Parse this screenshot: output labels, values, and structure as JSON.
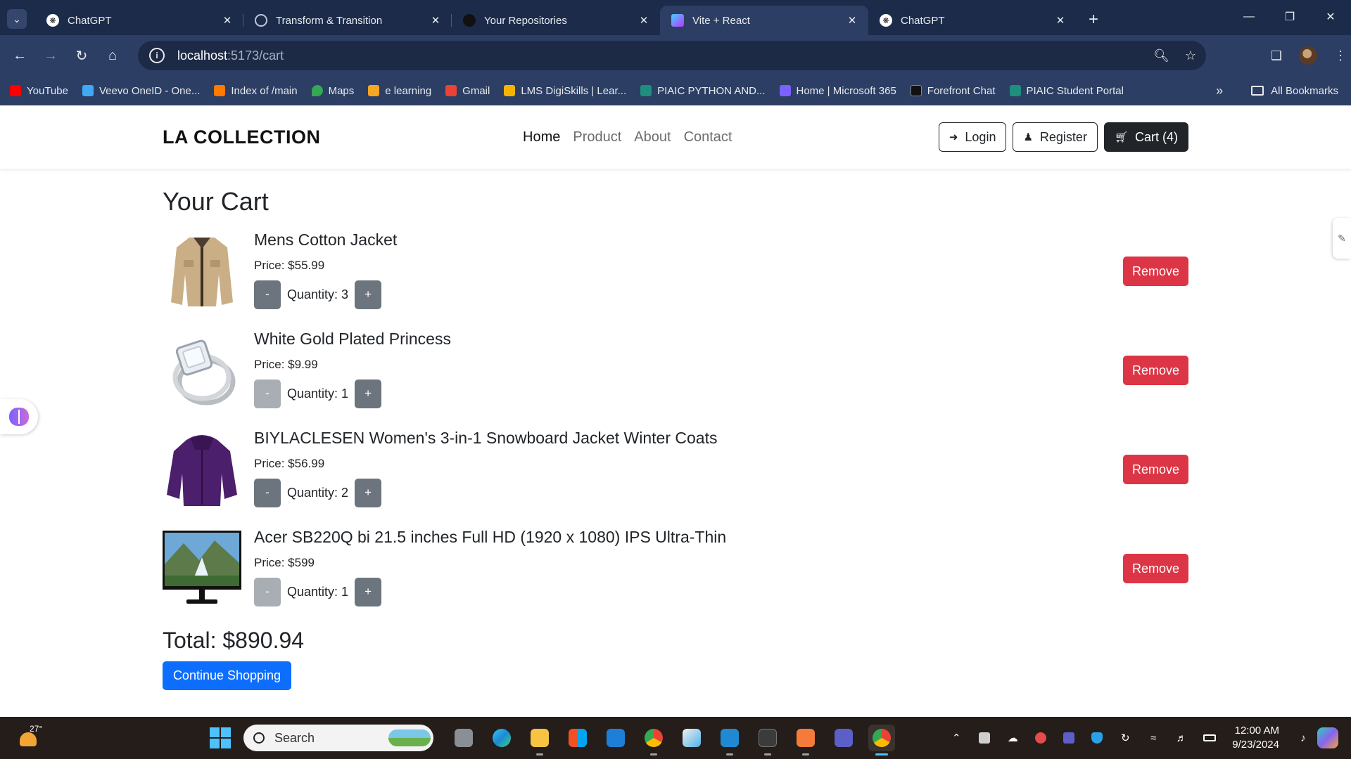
{
  "browser": {
    "tabs": [
      {
        "title": "ChatGPT",
        "icon": "chatgpt-icon",
        "active": false
      },
      {
        "title": "Transform & Transition",
        "icon": "globe-icon",
        "active": false
      },
      {
        "title": "Your Repositories",
        "icon": "github-icon",
        "active": false
      },
      {
        "title": "Vite + React",
        "icon": "vite-icon",
        "active": true
      },
      {
        "title": "ChatGPT",
        "icon": "chatgpt-icon",
        "active": false
      }
    ],
    "url_host": "localhost",
    "url_path": ":5173/cart",
    "bookmarks": [
      {
        "label": "YouTube",
        "color": "#ff0000"
      },
      {
        "label": "Veevo OneID - One...",
        "color": "#3fa9f5"
      },
      {
        "label": "Index of /main",
        "color": "#ff7a00"
      },
      {
        "label": "Maps",
        "color": "#34a853"
      },
      {
        "label": "e learning",
        "color": "#f5a623"
      },
      {
        "label": "Gmail",
        "color": "#ea4335"
      },
      {
        "label": "LMS DigiSkills | Lear...",
        "color": "#f6b400"
      },
      {
        "label": "PIAIC PYTHON AND...",
        "color": "#1e8e7e"
      },
      {
        "label": "Home | Microsoft 365",
        "color": "#7b61ff"
      },
      {
        "label": "Forefront Chat",
        "color": "#111111"
      },
      {
        "label": "PIAIC Student Portal",
        "color": "#1e8e7e"
      }
    ],
    "all_bookmarks_label": "All Bookmarks"
  },
  "site": {
    "brand": "LA COLLECTION",
    "menu": [
      "Home",
      "Product",
      "About",
      "Contact"
    ],
    "login_label": "Login",
    "register_label": "Register",
    "cart_label": "Cart (4)"
  },
  "cart": {
    "title": "Your Cart",
    "items": [
      {
        "name": "Mens Cotton Jacket",
        "price": "Price: $55.99",
        "quantity": "Quantity: 3",
        "thumbnail": "jacket-image"
      },
      {
        "name": "White Gold Plated Princess",
        "price": "Price: $9.99",
        "quantity": "Quantity: 1",
        "thumbnail": "ring-image"
      },
      {
        "name": "BIYLACLESEN Women's 3-in-1 Snowboard Jacket Winter Coats",
        "price": "Price: $56.99",
        "quantity": "Quantity: 2",
        "thumbnail": "purple-jacket-image"
      },
      {
        "name": "Acer SB220Q bi 21.5 inches Full HD (1920 x 1080) IPS Ultra-Thin",
        "price": "Price: $599",
        "quantity": "Quantity: 1",
        "thumbnail": "monitor-image"
      }
    ],
    "decrement_label": "-",
    "increment_label": "+",
    "remove_label": "Remove",
    "total": "Total: $890.94",
    "continue_label": "Continue Shopping"
  },
  "taskbar": {
    "temperature": "27°",
    "search_placeholder": "Search",
    "time": "12:00 AM",
    "date": "9/23/2024"
  },
  "colors": {
    "remove": "#dc3545",
    "primary": "#0d6efd",
    "secondary": "#6c757d",
    "dark": "#212529"
  }
}
